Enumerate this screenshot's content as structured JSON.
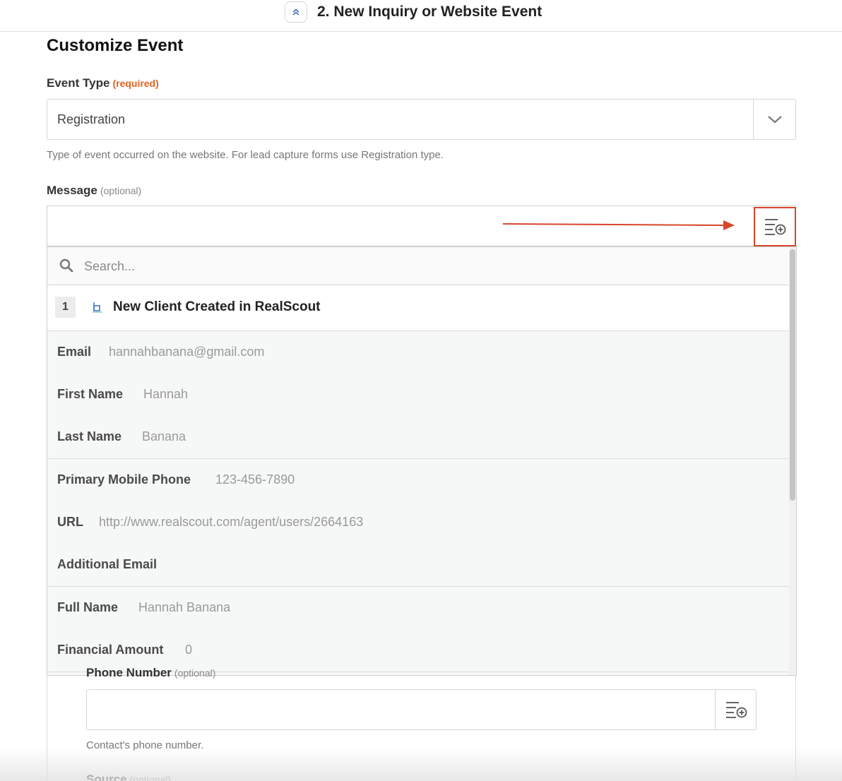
{
  "header": {
    "title": "2. New Inquiry or Website Event"
  },
  "section_title": "Customize Event",
  "event_type": {
    "label": "Event Type",
    "required_tag": "(required)",
    "value": "Registration",
    "help": "Type of event occurred on the website. For lead capture forms use Registration type."
  },
  "message": {
    "label": "Message",
    "optional_tag": "(optional)",
    "value": ""
  },
  "dropdown": {
    "search_placeholder": "Search...",
    "step": {
      "number": "1",
      "name": "New Client Created in RealScout",
      "icon": "realscout-app-icon"
    },
    "options": [
      {
        "key": "Email",
        "value": "hannahbanana@gmail.com"
      },
      {
        "key": "First Name",
        "value": "Hannah"
      },
      {
        "key": "Last Name",
        "value": "Banana"
      },
      {
        "key": "Primary Mobile Phone",
        "value": "123-456-7890"
      },
      {
        "key": "URL",
        "value": "http://www.realscout.com/agent/users/2664163"
      },
      {
        "key": "Additional Email",
        "value": ""
      },
      {
        "key": "Full Name",
        "value": "Hannah Banana"
      },
      {
        "key": "Financial Amount",
        "value": "0"
      }
    ]
  },
  "phone": {
    "label": "Phone Number",
    "optional_tag": "(optional)",
    "help": "Contact's phone number."
  },
  "source": {
    "label": "Source",
    "optional_tag": "(optional)"
  },
  "colors": {
    "accent_orange": "#e06420",
    "highlight_red": "#d9452b"
  }
}
